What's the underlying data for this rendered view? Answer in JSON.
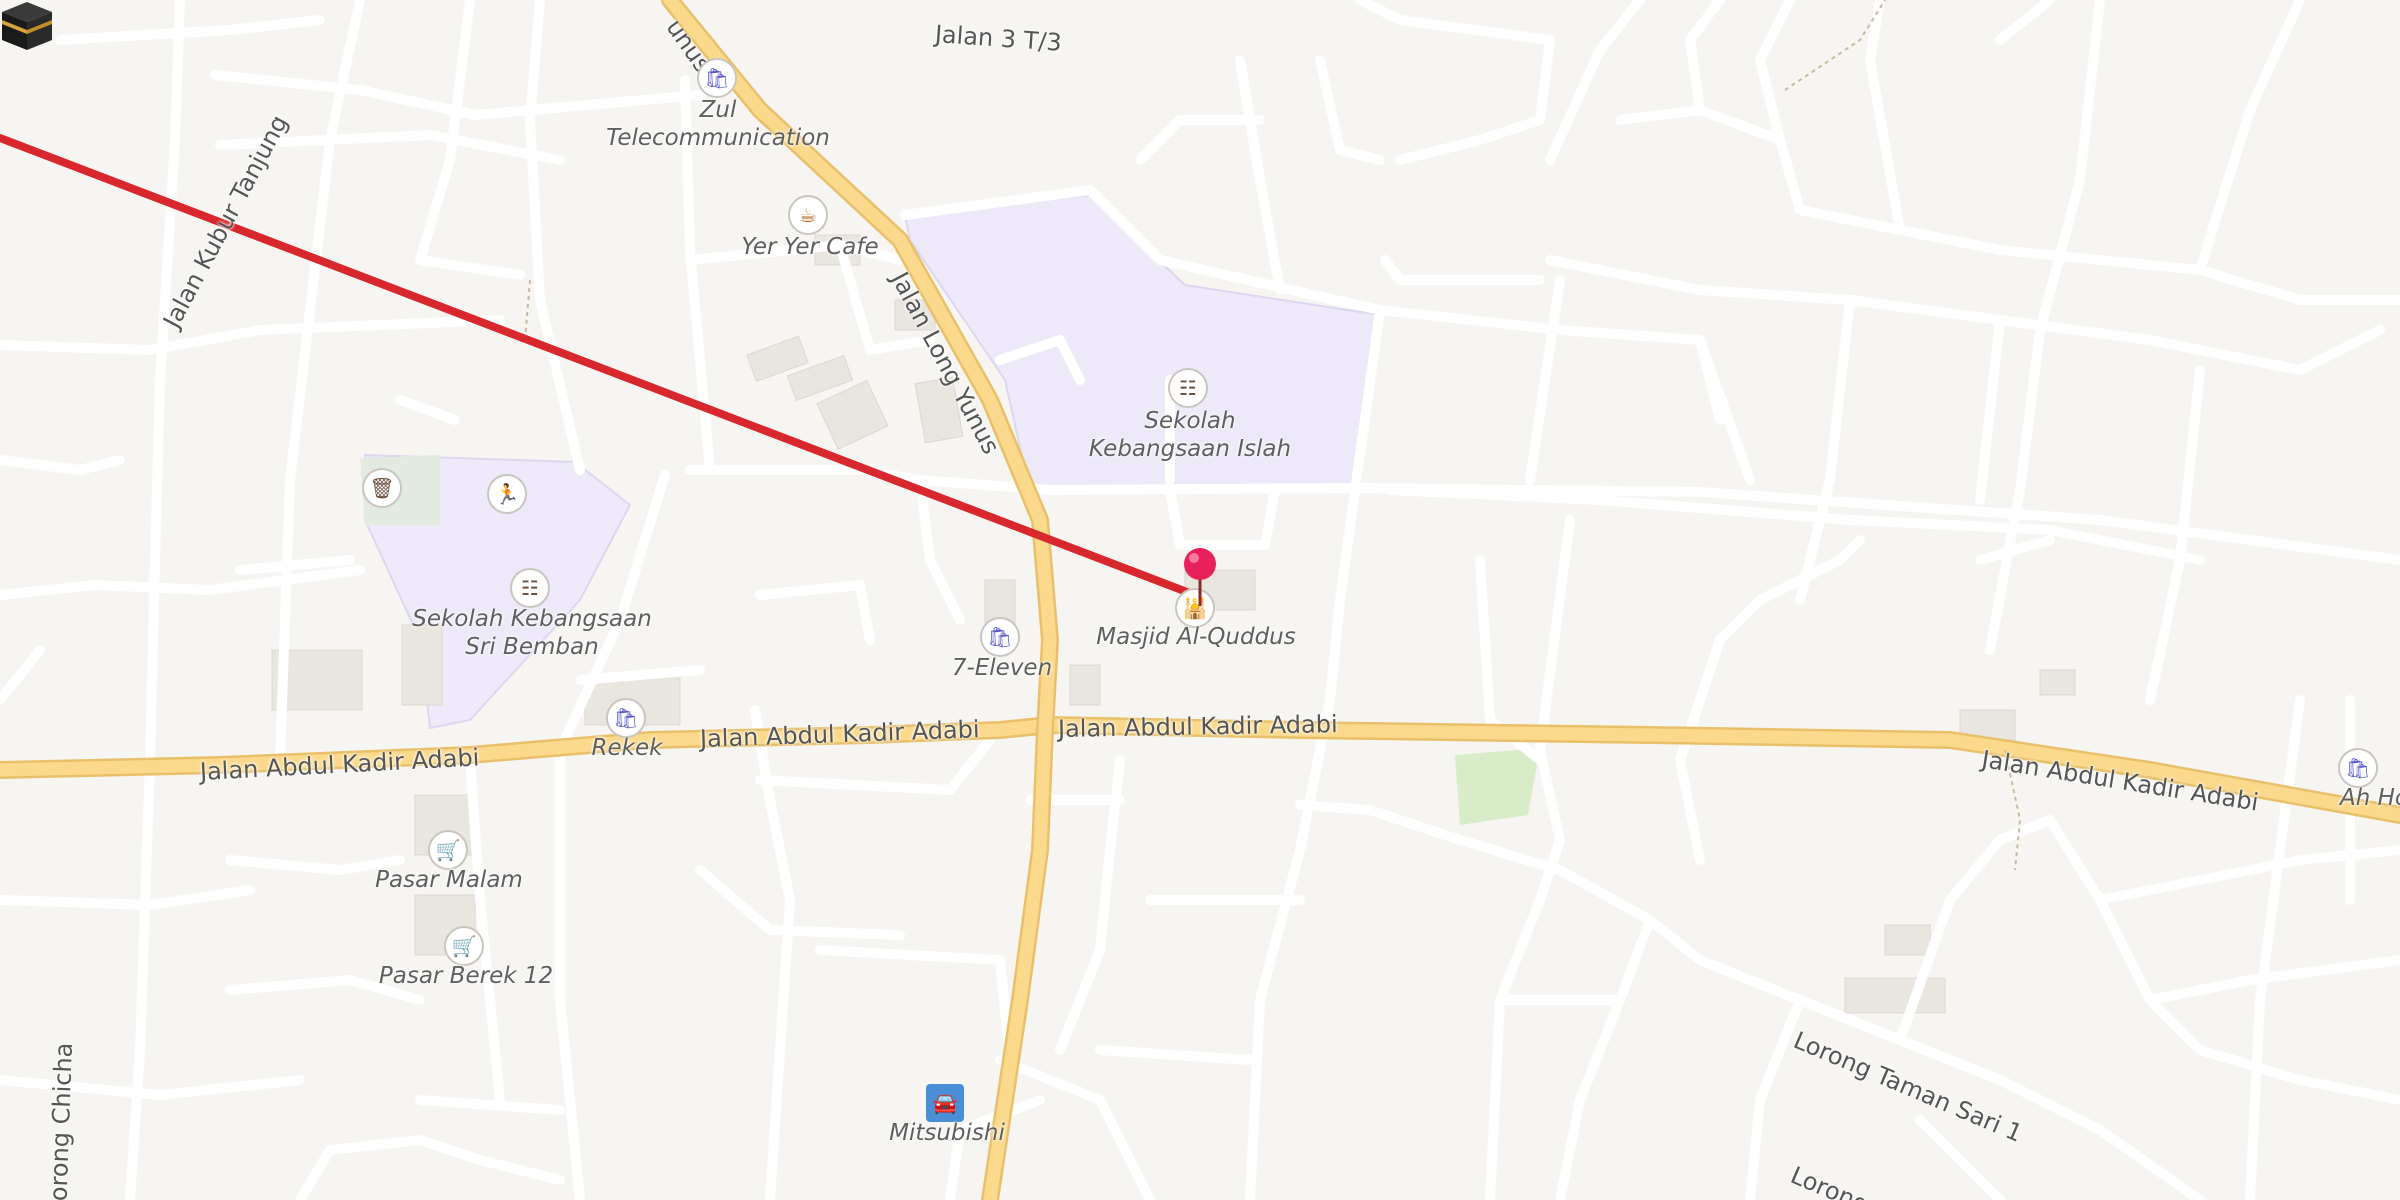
{
  "map": {
    "roads": {
      "major": {
        "jalan_3": "Jalan 3 T/3",
        "long_yunus_top": "unus",
        "long_yunus": "Jalan Long Yunus",
        "kubur_tanjung": "Jalan Kubur Tanjung",
        "adabi_west": "Jalan Abdul Kadir Adabi",
        "adabi_mid": "Jalan Abdul Kadir Adabi",
        "adabi_center": "Jalan Abdul Kadir Adabi",
        "adabi_east": "Jalan Abdul Kadir Adabi",
        "taman_sari": "Lorong Taman Sari 1",
        "lorong_chicha": "Lorong Chicha",
        "lorong_partial": "Lorong"
      }
    },
    "pois": {
      "zul": {
        "label": "Zul\nTelecommunication",
        "icon": "shopping-basket-icon"
      },
      "yer_yer": {
        "label": "Yer Yer Cafe",
        "icon": "coffee-cup-icon"
      },
      "islah": {
        "label": "Sekolah\nKebangsaan Islah",
        "icon": "school-icon"
      },
      "sri_bemban": {
        "label": "Sekolah Kebangsaan\nSri Bemban",
        "icon": "school-icon"
      },
      "masjid": {
        "label": "Masjid Al-Quddus",
        "icon": "mosque-icon"
      },
      "seven_eleven": {
        "label": "7-Eleven",
        "icon": "shopping-basket-icon"
      },
      "rekek": {
        "label": "Rekek",
        "icon": "shopping-basket-icon"
      },
      "pasar_malam": {
        "label": "Pasar Malam",
        "icon": "shopping-cart-icon"
      },
      "pasar_berek": {
        "label": "Pasar Berek 12",
        "icon": "shopping-cart-icon"
      },
      "mitsubishi": {
        "label": "Mitsubishi",
        "icon": "car-icon"
      },
      "ah_hong": {
        "label": "Ah Hong Mo",
        "icon": "shopping-basket-icon"
      },
      "waste": {
        "label": "",
        "icon": "waste-basket-icon"
      },
      "sports": {
        "label": "",
        "icon": "running-person-icon"
      }
    },
    "markers": {
      "qibla_line_color": "#d9272e",
      "kaaba_icon": "kaaba-icon",
      "location_pin_color": "#e8215a",
      "location_pin_icon": "location-pin-icon"
    },
    "colors": {
      "background": "#f7f5f2",
      "road": "#ffffff",
      "major_road": "#fbd98c",
      "school_area": "#ede9f8",
      "park": "#d8ecc8"
    }
  }
}
